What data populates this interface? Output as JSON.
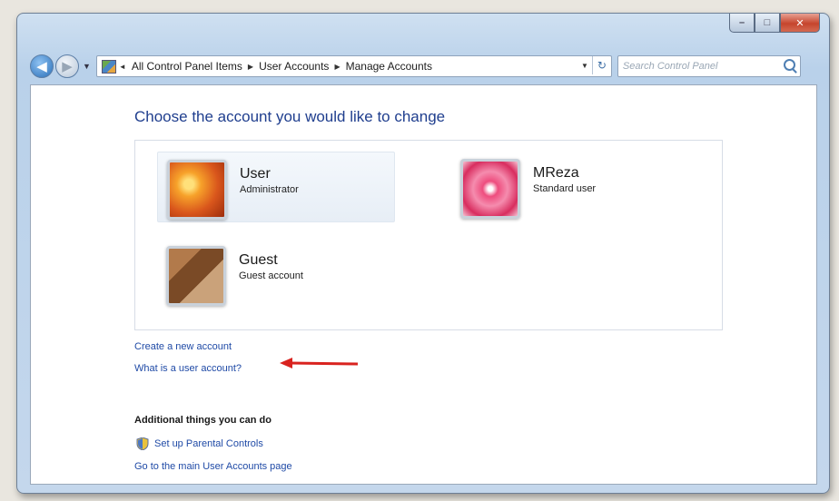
{
  "window": {
    "caption_min": "–",
    "caption_max": "□",
    "caption_close": "✕"
  },
  "navbar": {
    "back_glyph": "◀",
    "forward_glyph": "▶",
    "breadcrumbs": [
      "All Control Panel Items",
      "User Accounts",
      "Manage Accounts"
    ],
    "refresh_glyph": "↻",
    "search_placeholder": "Search Control Panel"
  },
  "main": {
    "heading": "Choose the account you would like to change",
    "accounts": [
      {
        "name": "User",
        "role": "Administrator",
        "picture": "flower"
      },
      {
        "name": "MReza",
        "role": "Standard user",
        "picture": "star"
      },
      {
        "name": "Guest",
        "role": "Guest account",
        "picture": "briefcase"
      }
    ],
    "links": {
      "create_account": "Create a new account",
      "what_is_account": "What is a user account?"
    },
    "additional": {
      "title": "Additional things you can do",
      "parental_controls": "Set up Parental Controls",
      "main_page": "Go to the main User Accounts page"
    }
  },
  "colors": {
    "link": "#1f4aa6",
    "heading": "#1f3e8e",
    "annotation_arrow": "#d9231f"
  }
}
